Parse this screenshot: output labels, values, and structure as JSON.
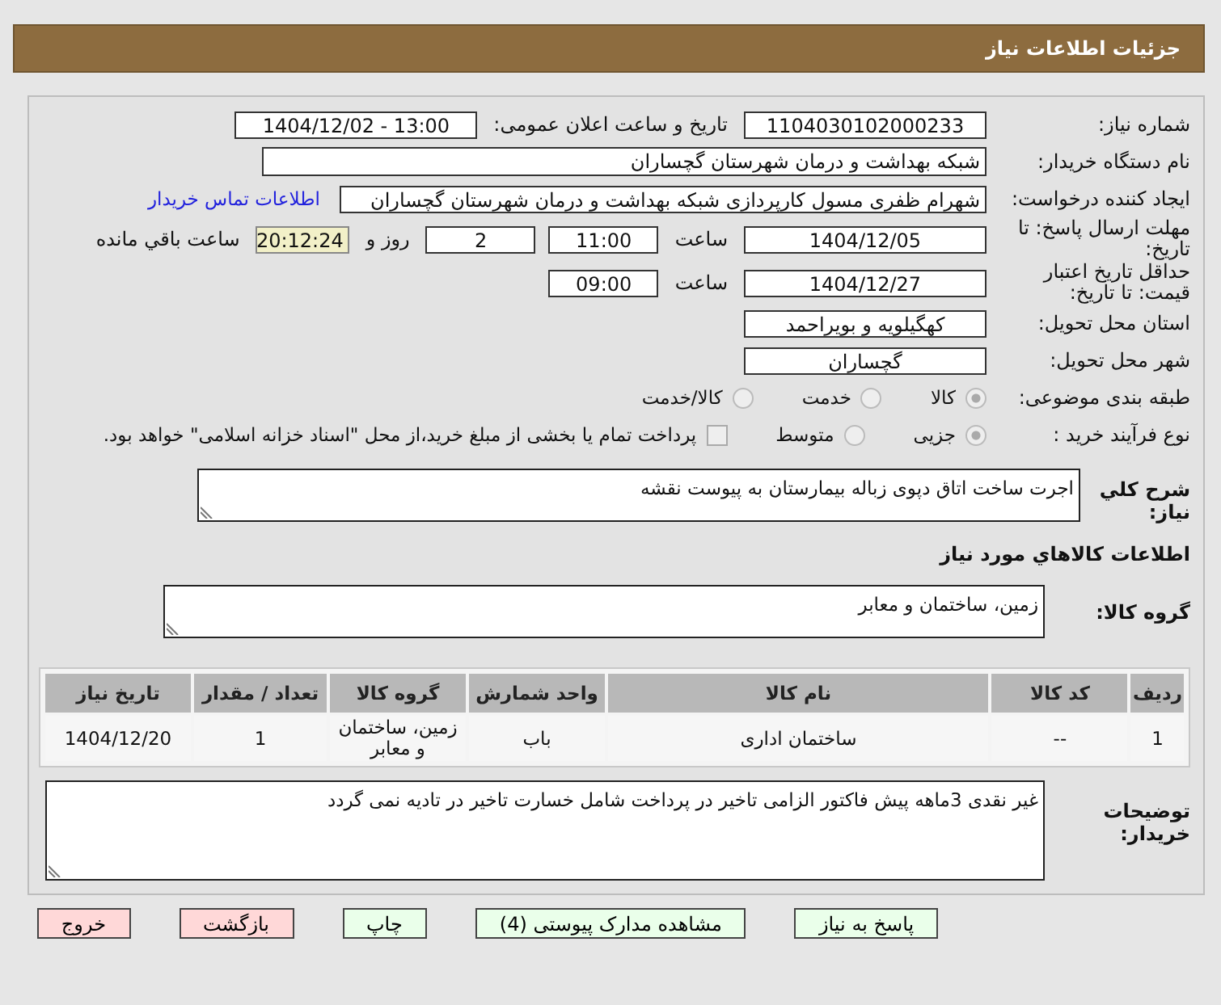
{
  "header": {
    "title": "جزئیات اطلاعات نیاز"
  },
  "rows": [
    {
      "label": "شماره نیاز:",
      "items": [
        {
          "kind": "field",
          "text": "1104030102000233"
        },
        {
          "kind": "text",
          "text": "تاریخ و ساعت اعلان عمومی:"
        },
        {
          "kind": "field",
          "text": "1404/12/02 - 13:00"
        }
      ]
    },
    {
      "label": "نام دستگاه خریدار:",
      "items": [
        {
          "kind": "wide_field",
          "text": "شبکه بهداشت و درمان شهرستان گچساران"
        }
      ]
    },
    {
      "label": "ایجاد کننده درخواست:",
      "items": [
        {
          "kind": "long_field",
          "text": "شهرام ظفری مسول کارپردازی  شبکه بهداشت و درمان شهرستان گچساران"
        },
        {
          "kind": "link",
          "text": "اطلاعات تماس خریدار"
        }
      ]
    },
    {
      "label": "مهلت ارسال پاسخ: تا تاریخ:",
      "items": [
        {
          "kind": "field",
          "text": "1404/12/05"
        },
        {
          "kind": "text",
          "text": "ساعت"
        },
        {
          "kind": "short_field",
          "text": "11:00"
        },
        {
          "kind": "short_field",
          "text": "2"
        },
        {
          "kind": "text",
          "text": "روز و"
        },
        {
          "kind": "timer",
          "text": "20:12:24"
        },
        {
          "kind": "text",
          "text": "ساعت باقي مانده"
        }
      ]
    },
    {
      "label": "حداقل تاریخ اعتبار قیمت: تا تاریخ:",
      "items": [
        {
          "kind": "field",
          "text": "1404/12/27"
        },
        {
          "kind": "text",
          "text": "ساعت"
        },
        {
          "kind": "short_field",
          "text": "09:00"
        }
      ]
    },
    {
      "label": "استان محل تحویل:",
      "items": [
        {
          "kind": "field",
          "text": "کهگیلویه و بویراحمد"
        }
      ]
    },
    {
      "label": "شهر محل تحویل:",
      "items": [
        {
          "kind": "field",
          "text": "گچساران"
        }
      ]
    },
    {
      "label": "طبقه بندی موضوعی:",
      "items": [
        {
          "kind": "radio",
          "text": "کالا",
          "selected": true
        },
        {
          "kind": "radio",
          "text": "خدمت",
          "selected": false
        },
        {
          "kind": "radio",
          "text": "کالا/خدمت",
          "selected": false
        }
      ]
    },
    {
      "label": "نوع فرآیند خرید :",
      "items": [
        {
          "kind": "radio",
          "text": "جزیی",
          "selected": true
        },
        {
          "kind": "radio",
          "text": "متوسط",
          "selected": false
        },
        {
          "kind": "checkbox",
          "text": "پرداخت تمام یا بخشی از مبلغ خرید،از محل \"اسناد خزانه اسلامی\" خواهد بود.",
          "checked": false
        }
      ]
    }
  ],
  "description": {
    "label": "شرح کلي نیاز:",
    "value": "اجرت ساخت اتاق دپوی زباله بیمارستان به پیوست نقشه"
  },
  "goods_heading": "اطلاعات کالاهاي مورد نیاز",
  "goods_group": {
    "label": "گروه کالا:",
    "value": "زمین، ساختمان و معابر"
  },
  "table": {
    "columns": [
      "ردیف",
      "کد کالا",
      "نام کالا",
      "واحد شمارش",
      "گروه کالا",
      "تعداد / مقدار",
      "تاریخ نیاز"
    ],
    "rows": [
      [
        "1",
        "--",
        "ساختمان اداری",
        "باب",
        "زمین، ساختمان و معابر",
        "1",
        "1404/12/20"
      ]
    ]
  },
  "buyer_notes": {
    "label": "توضیحات خریدار:",
    "value": "غیر نقدی 3ماهه پیش فاکتور الزامی تاخیر در پرداخت شامل خسارت تاخیر در تادیه نمی گردد"
  },
  "buttons": [
    {
      "label": "پاسخ به نیاز",
      "color": "#eaffea"
    },
    {
      "label": "مشاهده مدارک پیوستی (4)",
      "color": "#eaffea"
    },
    {
      "label": "چاپ",
      "color": "#eaffea"
    },
    {
      "label": "بازگشت",
      "color": "#ffd8d8"
    },
    {
      "label": "خروج",
      "color": "#ffd8d8"
    }
  ]
}
